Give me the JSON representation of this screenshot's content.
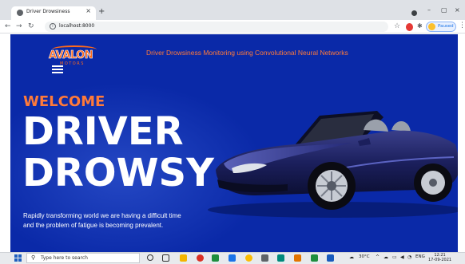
{
  "browser": {
    "tab": {
      "title": "Driver Drowsiness",
      "close_glyph": "×",
      "favicon": "globe-icon"
    },
    "new_tab_glyph": "+",
    "window_controls": {
      "minimize": "–",
      "maximize": "▢",
      "close": "×"
    },
    "toolbar": {
      "back": "←",
      "forward": "→",
      "reload": "↻",
      "url": "localhost:8000",
      "star": "☆",
      "profile_status": "Paused",
      "menu": "⋮"
    }
  },
  "page": {
    "logo": {
      "word": "AVALON",
      "sub": "MOTORS"
    },
    "headline": "Driver Drowsiness Monitoring using Convolutional Neural Networks",
    "welcome": "WELCOME",
    "hero_line1": "DRIVER",
    "hero_line2": "DROWSY",
    "tagline_line1": "Rapidly transforming world we are having a difficult time",
    "tagline_line2": "and the problem of fatigue is becoming prevalent."
  },
  "taskbar": {
    "search_placeholder": "Type here to search",
    "weather": "30°C",
    "language": "ENG",
    "time": "12:21",
    "date": "17-09-2021"
  },
  "colors": {
    "page_bg": "#0a29a8",
    "accent": "#ff7a3a"
  }
}
